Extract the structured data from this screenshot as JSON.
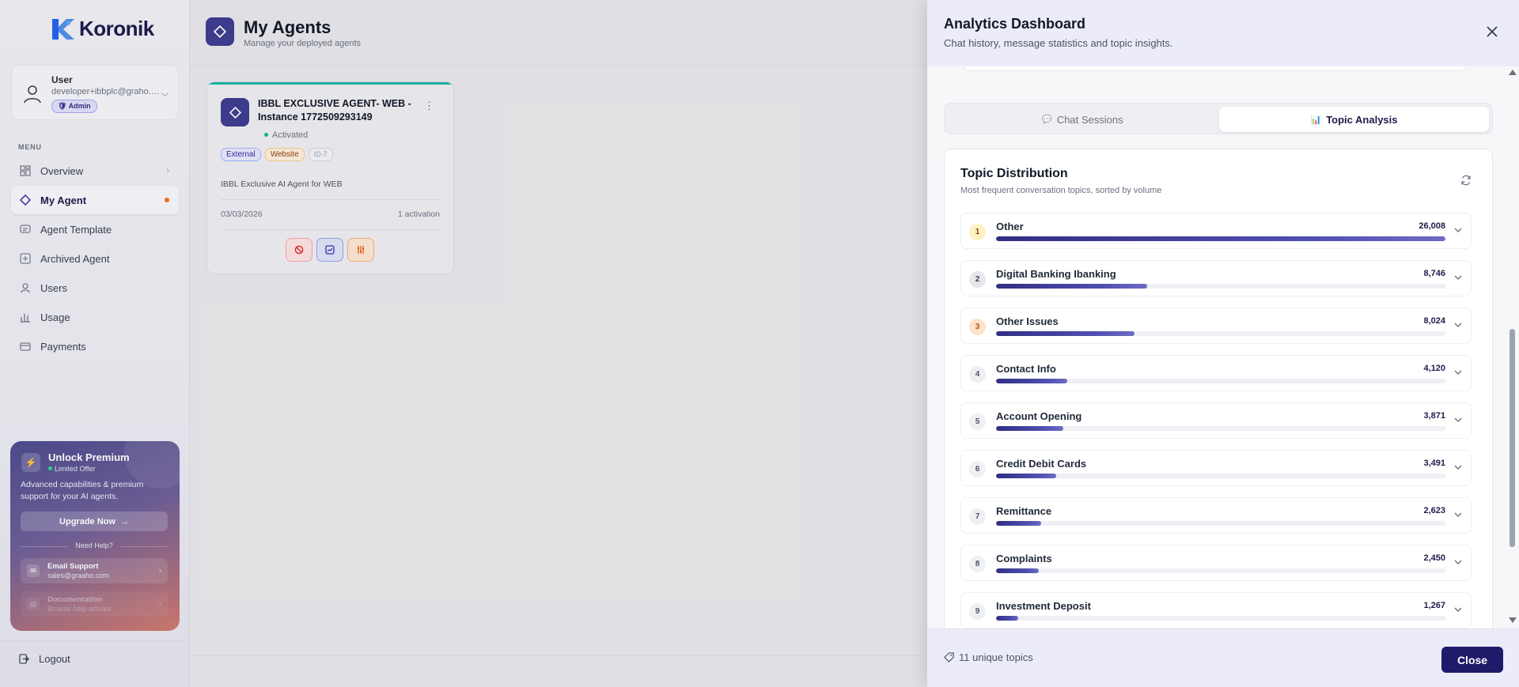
{
  "brand": {
    "name": "Koronik"
  },
  "user": {
    "name": "User",
    "email": "developer+ibbplc@graho.com",
    "role": "Admin"
  },
  "menu": {
    "label": "MENU",
    "items": [
      {
        "label": "Overview",
        "icon": "grid-icon"
      },
      {
        "label": "My Agent",
        "icon": "diamond-icon"
      },
      {
        "label": "Agent Template",
        "icon": "template-icon"
      },
      {
        "label": "Archived Agent",
        "icon": "archive-icon"
      },
      {
        "label": "Users",
        "icon": "user-icon"
      },
      {
        "label": "Usage",
        "icon": "bar-chart-icon"
      },
      {
        "label": "Payments",
        "icon": "wallet-icon"
      }
    ]
  },
  "premium": {
    "title": "Unlock Premium",
    "offer": "Limited Offer",
    "description": "Advanced capabilities & premium support for your AI agents.",
    "button": "Upgrade Now",
    "help_label": "Need Help?",
    "email_title": "Email Support",
    "email_sub": "sales@graaho.com",
    "docs_title": "Documentation",
    "docs_sub": "Browse help articles"
  },
  "logout": "Logout",
  "main": {
    "title": "My Agents",
    "subtitle": "Manage your deployed agents",
    "agent": {
      "name": "IBBL EXCLUSIVE AGENT- WEB - Instance 1772509293149",
      "status": "Activated",
      "tags": [
        "External",
        "Website",
        "ID-7"
      ],
      "description": "IBBL Exclusive AI Agent for WEB",
      "date": "03/03/2026",
      "activations": "1 activation"
    }
  },
  "panel": {
    "title": "Analytics Dashboard",
    "subtitle": "Chat history, message statistics and topic insights.",
    "tabs": [
      {
        "label": "Chat Sessions",
        "icon": "💬"
      },
      {
        "label": "Topic Analysis",
        "icon": "📊"
      }
    ],
    "distribution": {
      "title": "Topic Distribution",
      "subtitle": "Most frequent conversation topics, sorted by volume"
    },
    "footer": {
      "info": "11 unique topics",
      "close": "Close"
    }
  },
  "chart_data": {
    "type": "bar",
    "categories": [
      "Other",
      "Digital Banking Ibanking",
      "Other Issues",
      "Contact Info",
      "Account Opening",
      "Credit Debit Cards",
      "Remittance",
      "Complaints",
      "Investment Deposit"
    ],
    "values": [
      26008,
      8746,
      8024,
      4120,
      3871,
      3491,
      2623,
      2450,
      1267
    ],
    "value_labels": [
      "26,008",
      "8,746",
      "8,024",
      "4,120",
      "3,871",
      "3,491",
      "2,623",
      "2,450",
      "1,267"
    ],
    "ranks": [
      "1",
      "2",
      "3",
      "4",
      "5",
      "6",
      "7",
      "8",
      "9"
    ],
    "orientation": "horizontal",
    "colors": {
      "bar": "#312e81",
      "track": "#eef0f4"
    }
  }
}
